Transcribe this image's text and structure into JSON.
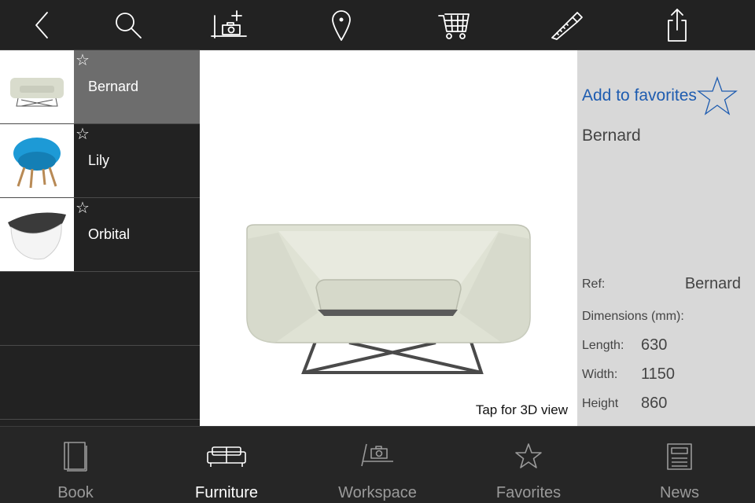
{
  "toolbar": {
    "buttons": [
      {
        "icon": "back-chevron-icon"
      },
      {
        "icon": "search-icon"
      },
      {
        "icon": "add-photo-icon"
      },
      {
        "icon": "location-pin-icon"
      },
      {
        "icon": "shopping-cart-icon"
      },
      {
        "icon": "saw-icon"
      },
      {
        "icon": "share-icon"
      }
    ]
  },
  "list": {
    "items": [
      {
        "label": "Bernard",
        "star": "☆",
        "selected": true,
        "thumb": "sofa-thumbnail"
      },
      {
        "label": "Lily",
        "star": "☆",
        "selected": false,
        "thumb": "blue-chair-thumbnail"
      },
      {
        "label": "Orbital",
        "star": "☆",
        "selected": false,
        "thumb": "shell-chair-thumbnail"
      }
    ]
  },
  "preview": {
    "tap_label": "Tap for 3D view",
    "image": "bernard-armchair-image"
  },
  "details": {
    "favorites_label": "Add to favorites",
    "product_name": "Bernard",
    "ref_label": "Ref:",
    "ref_value": "Bernard",
    "dimensions_label": "Dimensions (mm):",
    "length_label": "Length:",
    "length_value": "630",
    "width_label": "Width:",
    "width_value": "1150",
    "height_label": "Height",
    "height_value": "860"
  },
  "tabs": [
    {
      "label": "Book",
      "icon": "book-icon",
      "active": false
    },
    {
      "label": "Furniture",
      "icon": "sofa-icon",
      "active": true
    },
    {
      "label": "Workspace",
      "icon": "workspace-camera-icon",
      "active": false
    },
    {
      "label": "Favorites",
      "icon": "star-icon",
      "active": false
    },
    {
      "label": "News",
      "icon": "news-icon",
      "active": false
    }
  ],
  "colors": {
    "accent_blue": "#1e5cb0",
    "toolbar_bg": "#222222",
    "selected_row": "#6d6d6d",
    "details_bg": "#d8d8d8"
  }
}
